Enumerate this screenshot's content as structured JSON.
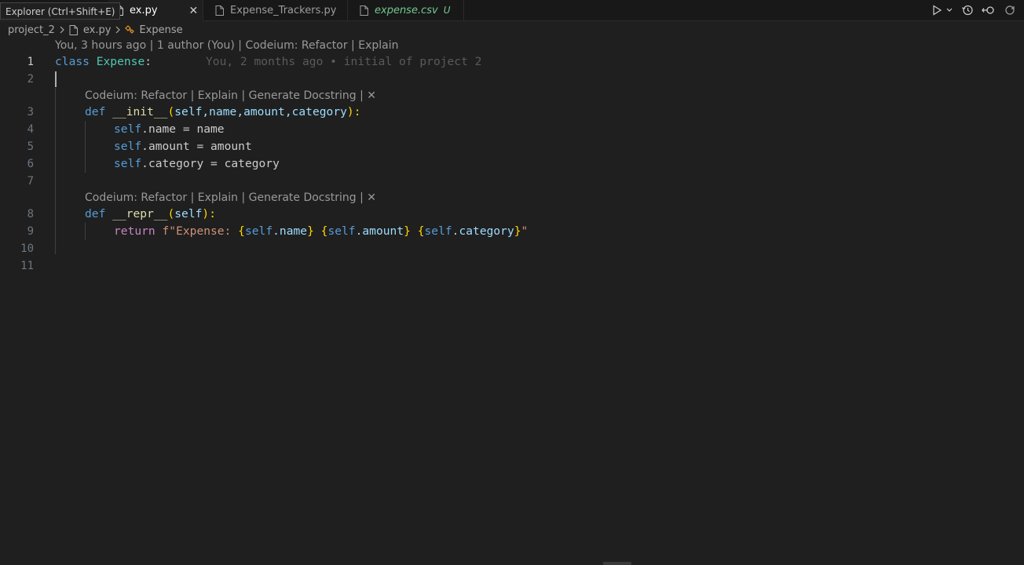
{
  "tooltip": "Explorer (Ctrl+Shift+E)",
  "tabs": [
    {
      "label": "ex.py",
      "active": true,
      "close": "✕"
    },
    {
      "label": "Expense_Trackers.py",
      "active": false
    },
    {
      "label": "expense.csv",
      "active": false,
      "badge": "U"
    }
  ],
  "breadcrumb": {
    "folder": "project_2",
    "file": "ex.py",
    "symbol": "Expense"
  },
  "codelens_top": "You, 3 hours ago | 1 author (You) | Codeium: Refactor | Explain",
  "codelens_def": "Codeium: Refactor | Explain | Generate Docstring | ✕",
  "blame_line1": "You, 2 months ago • initial of project 2",
  "line_numbers": [
    "1",
    "2",
    "3",
    "4",
    "5",
    "6",
    "7",
    "8",
    "9",
    "10",
    "11"
  ],
  "code": {
    "l1_kw": "class",
    "l1_name": "Expense",
    "l1_colon": ":",
    "l3_kw": "def",
    "l3_fn": "__init__",
    "l3_params": "self,name,amount,category",
    "l3_end": "):",
    "l4_self": "self",
    "l4_rest": ".name = name",
    "l5_self": "self",
    "l5_rest": ".amount = amount",
    "l6_self": "self",
    "l6_rest": ".category = category",
    "l8_kw": "def",
    "l8_fn": "__repr__",
    "l8_param": "self",
    "l8_end": "):",
    "l9_ret": "return",
    "l9_f": "f\"Expense: ",
    "l9_o1": "{",
    "l9_s1": "self",
    "l9_a1": ".name",
    "l9_c1": "}",
    "l9_o2": "{",
    "l9_s2": "self",
    "l9_a2": ".amount",
    "l9_c2": "}",
    "l9_o3": "{",
    "l9_s3": "self",
    "l9_a3": ".category",
    "l9_c3": "}",
    "l9_q": "\""
  },
  "colors": {
    "keyword": "#569cd6",
    "class": "#4ec9b0",
    "function": "#dcdcaa",
    "string": "#ce9178",
    "untracked": "#73c991"
  }
}
